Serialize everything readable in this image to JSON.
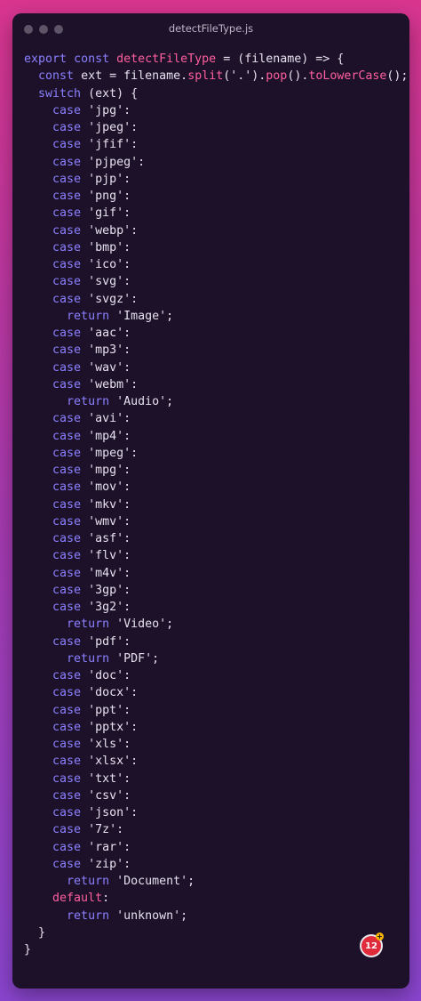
{
  "window": {
    "title": "detectFileType.js"
  },
  "badge": {
    "text": "12",
    "plus": "+"
  },
  "code_lines": [
    "export const detectFileType = (filename) => {",
    "  const ext = filename.split('.').pop().toLowerCase();",
    "  switch (ext) {",
    "    case 'jpg':",
    "    case 'jpeg':",
    "    case 'jfif':",
    "    case 'pjpeg':",
    "    case 'pjp':",
    "    case 'png':",
    "    case 'gif':",
    "    case 'webp':",
    "    case 'bmp':",
    "    case 'ico':",
    "    case 'svg':",
    "    case 'svgz':",
    "      return 'Image';",
    "    case 'aac':",
    "    case 'mp3':",
    "    case 'wav':",
    "    case 'webm':",
    "      return 'Audio';",
    "    case 'avi':",
    "    case 'mp4':",
    "    case 'mpeg':",
    "    case 'mpg':",
    "    case 'mov':",
    "    case 'mkv':",
    "    case 'wmv':",
    "    case 'asf':",
    "    case 'flv':",
    "    case 'm4v':",
    "    case '3gp':",
    "    case '3g2':",
    "      return 'Video';",
    "    case 'pdf':",
    "      return 'PDF';",
    "    case 'doc':",
    "    case 'docx':",
    "    case 'ppt':",
    "    case 'pptx':",
    "    case 'xls':",
    "    case 'xlsx':",
    "    case 'txt':",
    "    case 'csv':",
    "    case 'json':",
    "    case '7z':",
    "    case 'rar':",
    "    case 'zip':",
    "      return 'Document';",
    "    default:",
    "      return 'unknown';",
    "  }",
    "}"
  ]
}
